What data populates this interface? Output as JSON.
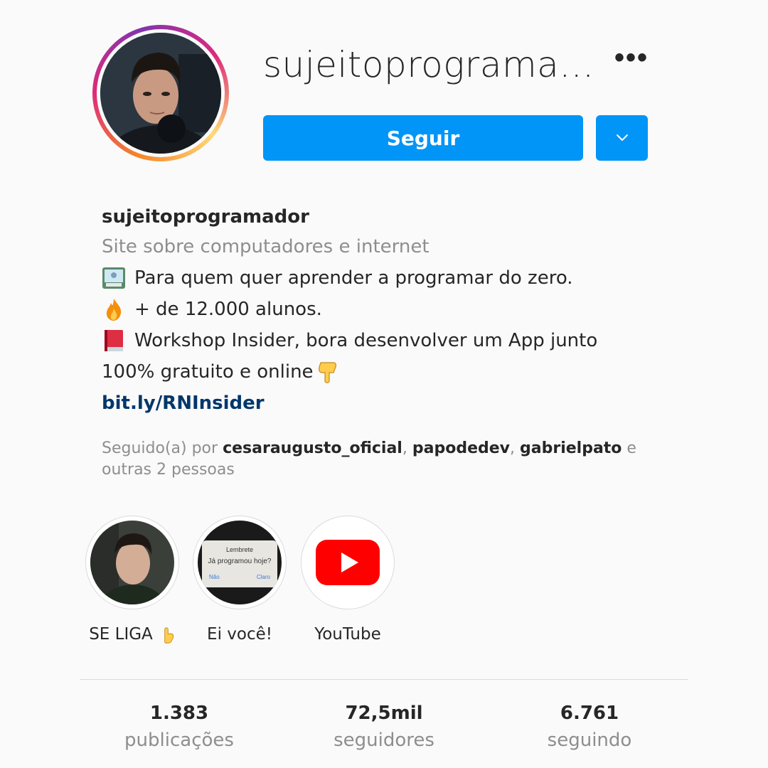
{
  "profile": {
    "username": "sujeitoprograma...",
    "follow_label": "Seguir",
    "more_icon": "•••"
  },
  "bio": {
    "name": "sujeitoprogramador",
    "category": "Site sobre computadores e internet",
    "lines": [
      "Para quem quer aprender a programar do zero.",
      "+ de 12.000 alunos.",
      "Workshop Insider, bora desenvolver um App junto",
      "100% gratuito e online"
    ],
    "link": "bit.ly/RNInsider"
  },
  "followed_by": {
    "prefix": "Seguido(a) por ",
    "users": [
      "cesaraugusto_oficial",
      "papodedev",
      "gabrielpato"
    ],
    "suffix": " e",
    "others": "outras 2 pessoas"
  },
  "highlights": [
    {
      "label": "SE LIGA"
    },
    {
      "label": "Ei você!",
      "inner_text_1": "Lembrete",
      "inner_text_2": "Já programou hoje?",
      "inner_text_3": "Não",
      "inner_text_4": "Claro"
    },
    {
      "label": "YouTube"
    }
  ],
  "stats": {
    "posts": {
      "value": "1.383",
      "label": "publicações"
    },
    "followers": {
      "value": "72,5mil",
      "label": "seguidores"
    },
    "following": {
      "value": "6.761",
      "label": "seguindo"
    }
  },
  "colors": {
    "primary_button": "#0095f6",
    "link": "#00376b",
    "secondary_text": "#8e8e8e",
    "youtube_red": "#ff0000"
  },
  "icons": [
    "more-options-icon",
    "chevron-down-icon",
    "laptop-emoji-icon",
    "fire-emoji-icon",
    "book-emoji-icon",
    "pointing-down-emoji-icon",
    "pointing-up-emoji-icon",
    "youtube-icon"
  ]
}
